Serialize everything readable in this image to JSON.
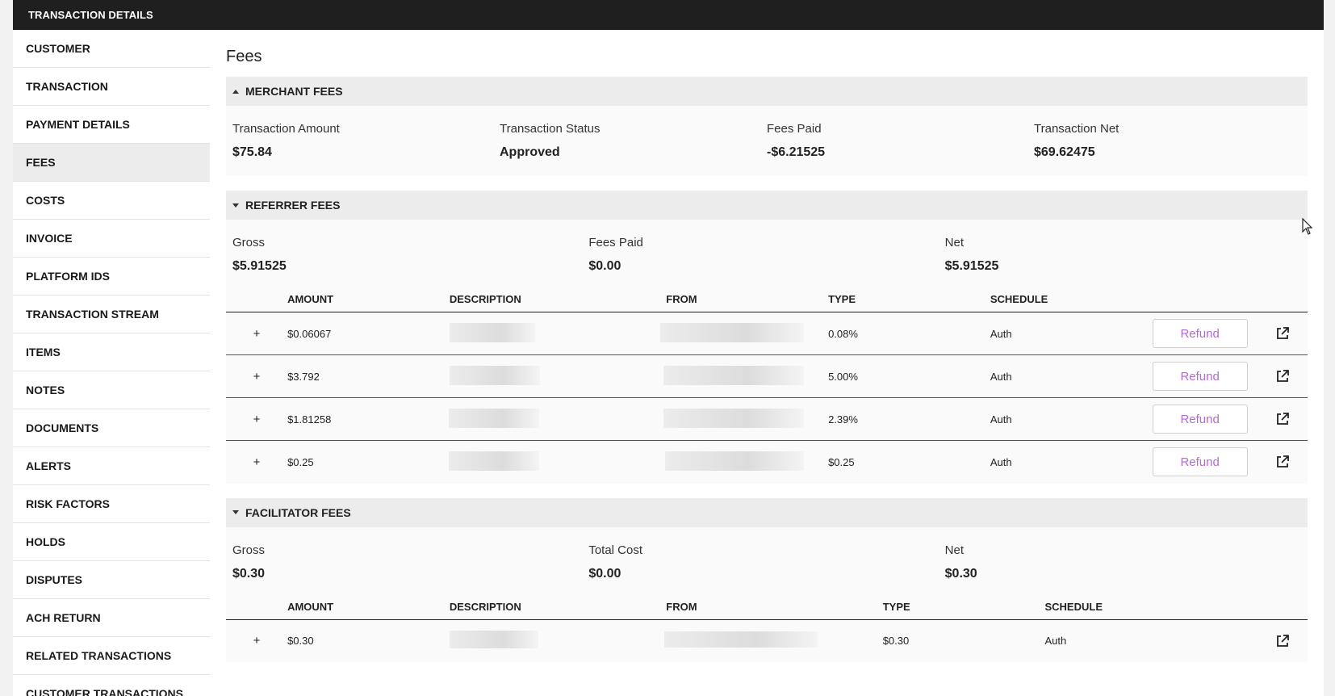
{
  "titlebar": {
    "title": "TRANSACTION DETAILS"
  },
  "sidebar": {
    "items": [
      {
        "label": "CUSTOMER"
      },
      {
        "label": "TRANSACTION"
      },
      {
        "label": "PAYMENT DETAILS"
      },
      {
        "label": "FEES"
      },
      {
        "label": "COSTS"
      },
      {
        "label": "INVOICE"
      },
      {
        "label": "PLATFORM IDS"
      },
      {
        "label": "TRANSACTION STREAM"
      },
      {
        "label": "ITEMS"
      },
      {
        "label": "NOTES"
      },
      {
        "label": "DOCUMENTS"
      },
      {
        "label": "ALERTS"
      },
      {
        "label": "RISK FACTORS"
      },
      {
        "label": "HOLDS"
      },
      {
        "label": "DISPUTES"
      },
      {
        "label": "ACH RETURN"
      },
      {
        "label": "RELATED TRANSACTIONS"
      },
      {
        "label": "CUSTOMER TRANSACTIONS"
      }
    ],
    "active": "FEES"
  },
  "main": {
    "title": "Fees",
    "merchant": {
      "header": "MERCHANT FEES",
      "fields": [
        {
          "label": "Transaction Amount",
          "value": "$75.84"
        },
        {
          "label": "Transaction Status",
          "value": "Approved"
        },
        {
          "label": "Fees Paid",
          "value": "-$6.21525"
        },
        {
          "label": "Transaction Net",
          "value": "$69.62475"
        }
      ]
    },
    "referrer": {
      "header": "REFERRER FEES",
      "fields": [
        {
          "label": "Gross",
          "value": "$5.91525"
        },
        {
          "label": "Fees Paid",
          "value": "$0.00"
        },
        {
          "label": "Net",
          "value": "$5.91525"
        }
      ],
      "columns": [
        "AMOUNT",
        "DESCRIPTION",
        "FROM",
        "TYPE",
        "SCHEDULE"
      ],
      "rows": [
        {
          "expand": "+",
          "amount": "$0.06067",
          "type": "0.08%",
          "schedule": "Auth",
          "action": "Refund"
        },
        {
          "expand": "+",
          "amount": "$3.792",
          "type": "5.00%",
          "schedule": "Auth",
          "action": "Refund"
        },
        {
          "expand": "+",
          "amount": "$1.81258",
          "type": "2.39%",
          "schedule": "Auth",
          "action": "Refund"
        },
        {
          "expand": "+",
          "amount": "$0.25",
          "type": "$0.25",
          "schedule": "Auth",
          "action": "Refund"
        }
      ]
    },
    "facilitator": {
      "header": "FACILITATOR FEES",
      "fields": [
        {
          "label": "Gross",
          "value": "$0.30"
        },
        {
          "label": "Total Cost",
          "value": "$0.00"
        },
        {
          "label": "Net",
          "value": "$0.30"
        }
      ],
      "columns": [
        "AMOUNT",
        "DESCRIPTION",
        "FROM",
        "TYPE",
        "SCHEDULE"
      ],
      "rows": [
        {
          "expand": "+",
          "amount": "$0.30",
          "type": "$0.30",
          "schedule": "Auth"
        }
      ]
    }
  },
  "icons": {
    "external": "external-link-icon",
    "cursor": "mouse-pointer-icon"
  },
  "colors": {
    "titlebar": "#1f1f1f",
    "refund_text": "#b06bd4",
    "section_header": "#ececec"
  }
}
